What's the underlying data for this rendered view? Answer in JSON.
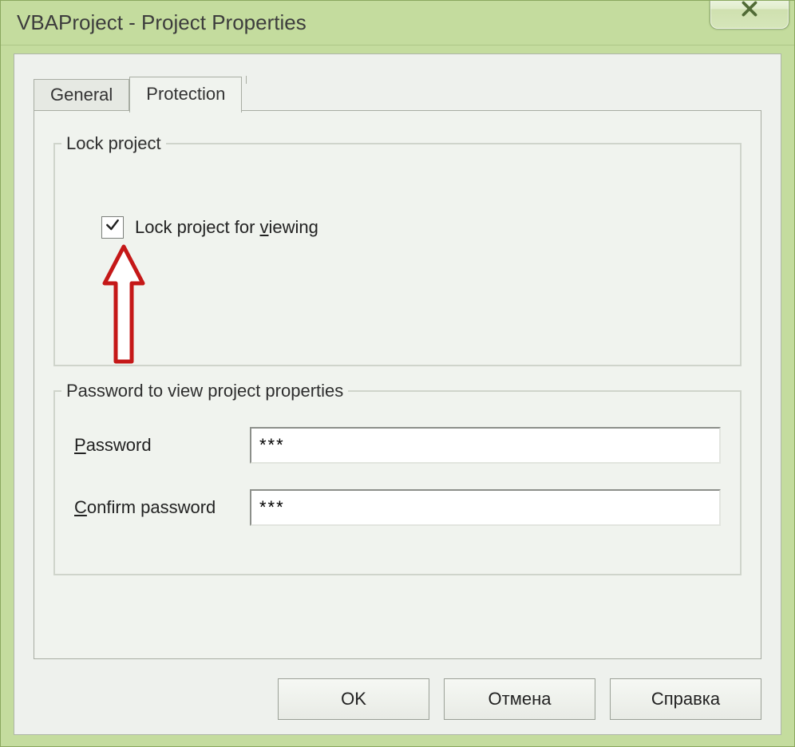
{
  "window": {
    "title": "VBAProject - Project Properties"
  },
  "tabs": {
    "general": "General",
    "protection": "Protection",
    "active": "protection"
  },
  "lock_group": {
    "legend": "Lock project",
    "checkbox_label_pre": "Lock project for ",
    "checkbox_label_ul": "v",
    "checkbox_label_post": "iewing",
    "checked": true
  },
  "password_group": {
    "legend": "Password to view project properties",
    "password_label_ul": "P",
    "password_label_post": "assword",
    "confirm_label_ul": "C",
    "confirm_label_post": "onfirm password",
    "password_value": "***",
    "confirm_value": "***"
  },
  "buttons": {
    "ok": "OK",
    "cancel": "Отмена",
    "help": "Справка"
  },
  "annotation": {
    "arrow_color": "#c51818"
  }
}
